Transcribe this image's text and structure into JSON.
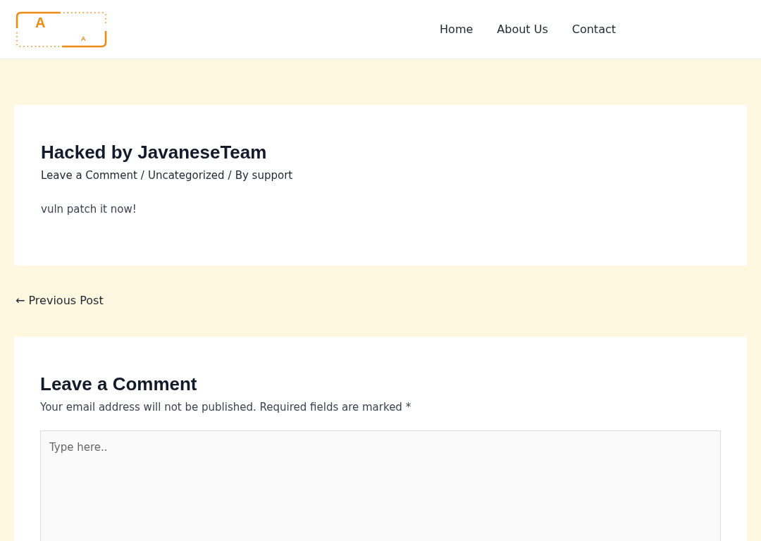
{
  "logo": {
    "letters": [
      "A",
      "A"
    ]
  },
  "nav": [
    {
      "label": "Home"
    },
    {
      "label": "About Us"
    },
    {
      "label": "Contact"
    }
  ],
  "post": {
    "title": "Hacked by JavaneseTeam",
    "meta": [
      "Leave a Comment",
      "Uncategorized",
      "By support"
    ],
    "meta_separator": "/",
    "body": "vuln patch it now!"
  },
  "previous_post": "← Previous Post",
  "comment": {
    "title": "Leave a Comment",
    "note": "Your email address will not be published. Required fields are marked *",
    "placeholder": "Type here.."
  }
}
